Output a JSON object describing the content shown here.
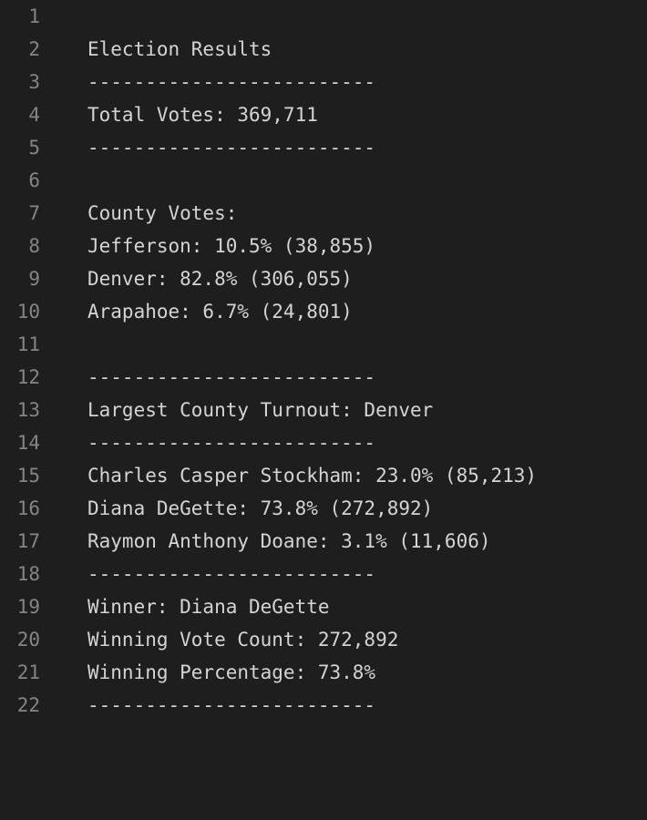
{
  "editor": {
    "lines": [
      "",
      "Election Results",
      "-------------------------",
      "Total Votes: 369,711",
      "-------------------------",
      "",
      "County Votes:",
      "Jefferson: 10.5% (38,855)",
      "Denver: 82.8% (306,055)",
      "Arapahoe: 6.7% (24,801)",
      "",
      "-------------------------",
      "Largest County Turnout: Denver",
      "-------------------------",
      "Charles Casper Stockham: 23.0% (85,213)",
      "Diana DeGette: 73.8% (272,892)",
      "Raymon Anthony Doane: 3.1% (11,606)",
      "-------------------------",
      "Winner: Diana DeGette",
      "Winning Vote Count: 272,892",
      "Winning Percentage: 73.8%",
      "-------------------------"
    ],
    "line_numbers": [
      "1",
      "2",
      "3",
      "4",
      "5",
      "6",
      "7",
      "8",
      "9",
      "10",
      "11",
      "12",
      "13",
      "14",
      "15",
      "16",
      "17",
      "18",
      "19",
      "20",
      "21",
      "22"
    ]
  },
  "colors": {
    "background": "#1e1e1e",
    "text": "#d4d4d4",
    "line_number": "#858585"
  }
}
